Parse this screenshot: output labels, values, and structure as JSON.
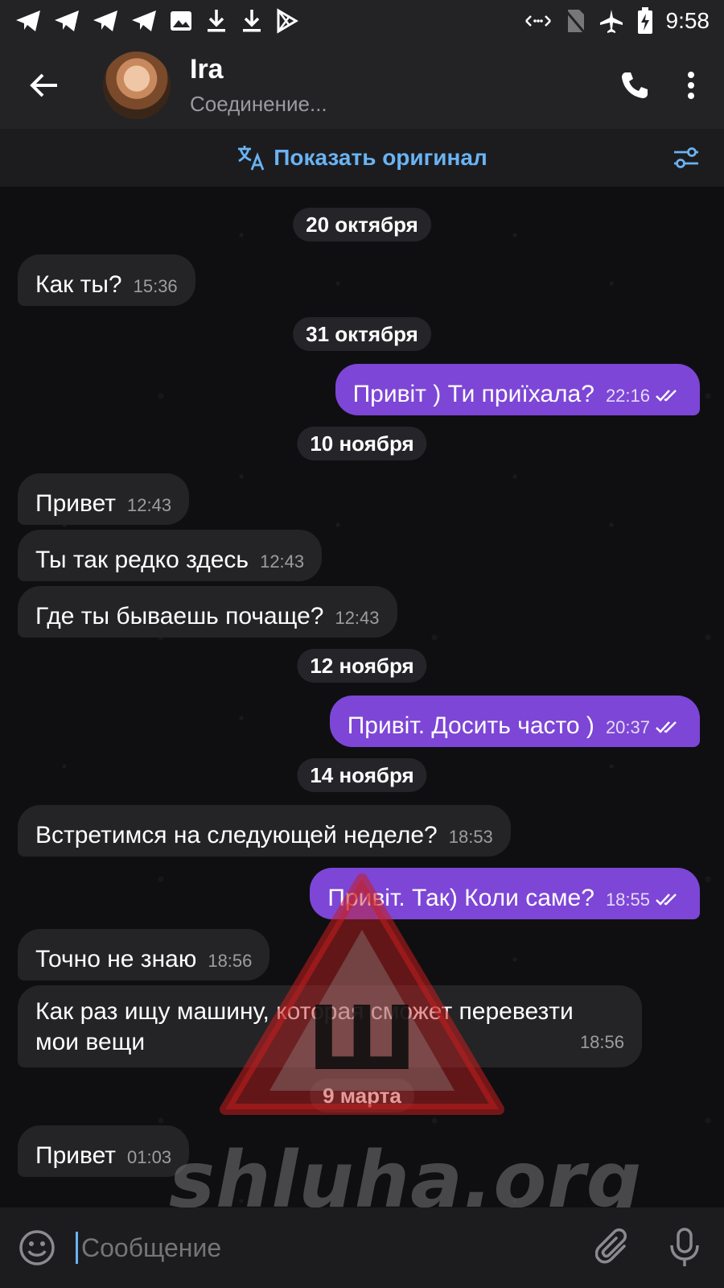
{
  "status_bar": {
    "time": "9:58",
    "left_icons": [
      "telegram-icon",
      "telegram-icon",
      "telegram-icon",
      "telegram-icon",
      "image-icon",
      "download-icon",
      "download-icon",
      "play-store-icon"
    ],
    "right_icons": [
      "data-arrows-icon",
      "no-sim-icon",
      "airplane-icon",
      "battery-charging-icon"
    ]
  },
  "header": {
    "name": "Ira",
    "status": "Соединение..."
  },
  "translate_bar": {
    "label": "Показать оригинал"
  },
  "dates": {
    "d1": "20 октября",
    "d2": "31 октября",
    "d3": "10 ноября",
    "d4": "12 ноября",
    "d5": "14 ноября",
    "d6": "9 марта"
  },
  "messages": [
    {
      "dir": "in",
      "text": "Как ты?",
      "time": "15:36"
    },
    {
      "dir": "out",
      "text": "Привіт ) Ти приїхала?",
      "time": "22:16",
      "read": true
    },
    {
      "dir": "in",
      "text": "Привет",
      "time": "12:43"
    },
    {
      "dir": "in",
      "text": "Ты так редко здесь",
      "time": "12:43"
    },
    {
      "dir": "in",
      "text": "Где ты бываешь почаще?",
      "time": "12:43"
    },
    {
      "dir": "out",
      "text": "Привіт. Досить часто )",
      "time": "20:37",
      "read": true
    },
    {
      "dir": "in",
      "text": "Встретимся на следующей неделе?",
      "time": "18:53"
    },
    {
      "dir": "out",
      "text": "Привіт. Так) Коли саме?",
      "time": "18:55",
      "read": true
    },
    {
      "dir": "in",
      "text": "Точно не знаю",
      "time": "18:56"
    },
    {
      "dir": "in",
      "text_line1": "Как раз ищу машину, которая сможет перевезти",
      "text_line2": "мои вещи",
      "time": "18:56"
    },
    {
      "dir": "in",
      "text": "Привет",
      "time": "01:03"
    }
  ],
  "watermark": {
    "text": "shluha.org",
    "letter": "Ш"
  },
  "composer": {
    "placeholder": "Сообщение"
  },
  "colors": {
    "accent": "#6ab3f3",
    "outgoing_bubble": "#7d46d6",
    "incoming_bubble": "#242427"
  }
}
